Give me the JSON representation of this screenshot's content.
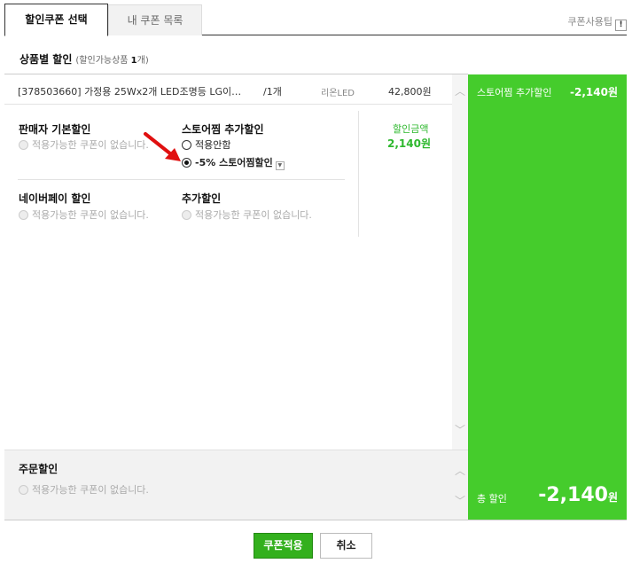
{
  "tabs": [
    {
      "label": "할인쿠폰 선택",
      "active": true
    },
    {
      "label": "내 쿠폰 목록",
      "active": false
    }
  ],
  "tip": {
    "label": "쿠폰사용팁",
    "icon": "info-icon",
    "icon_glyph": "!"
  },
  "section": {
    "title": "상품별 할인",
    "sub_prefix": "(할인가능상품 ",
    "sub_count": "1",
    "sub_suffix": "개)"
  },
  "product": {
    "name": "[378503660] 가정용 25Wx2개 LED조명등 LG이…",
    "qty": "/1개",
    "seller": "리온LED",
    "price": "42,800원"
  },
  "discount_amount": {
    "label": "할인금액",
    "value": "2,140원"
  },
  "blocks": {
    "seller_basic": {
      "title": "판매자 기본할인",
      "option": "적용가능한 쿠폰이 없습니다."
    },
    "store_extra": {
      "title": "스토어찜 추가할인",
      "option_none": "적용안함",
      "option_selected": "-5% 스토어찜할인",
      "dropdown_glyph": "▼"
    },
    "naverpay": {
      "title": "네이버페이 할인",
      "option": "적용가능한 쿠폰이 없습니다."
    },
    "extra": {
      "title": "추가할인",
      "option": "적용가능한 쿠폰이 없습니다."
    }
  },
  "order": {
    "title": "주문할인",
    "option": "적용가능한 쿠폰이 없습니다."
  },
  "summary": {
    "line_label": "스토어찜 추가할인",
    "line_value": "-2,140원",
    "total_label": "총 할인",
    "total_value": "-2,140",
    "total_unit": "원"
  },
  "scroll": {
    "up_glyph": "︿",
    "down_glyph": "﹀"
  },
  "buttons": {
    "apply": "쿠폰적용",
    "cancel": "취소"
  },
  "colors": {
    "accent_green": "#45cc2c",
    "button_green": "#33b01d",
    "arrow_red": "#e01010"
  }
}
